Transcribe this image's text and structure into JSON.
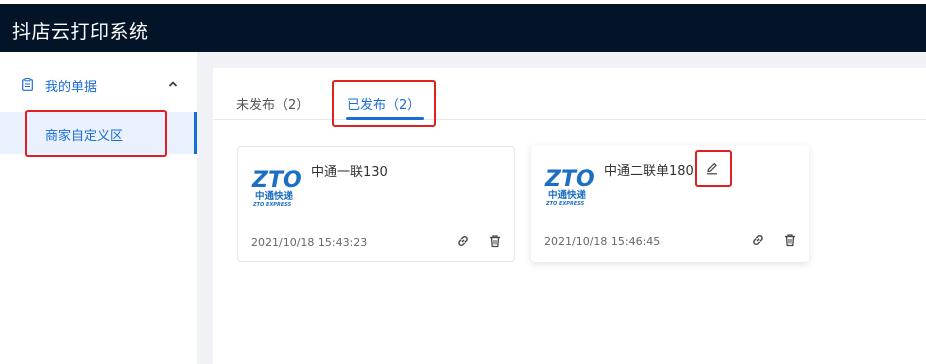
{
  "app": {
    "title": "抖店云打印系统"
  },
  "sidebar": {
    "group": {
      "label": "我的单据",
      "icon": "document-icon",
      "toggle_icon": "chevron-up-icon"
    },
    "items": [
      {
        "label": "商家自定义区",
        "active": true
      }
    ]
  },
  "tabs": [
    {
      "label": "未发布（2）",
      "active": false
    },
    {
      "label": "已发布（2）",
      "active": true
    }
  ],
  "cards": [
    {
      "name": "中通一联130",
      "date": "2021/10/18 15:43:23",
      "logo_text": "ZTO",
      "logo_sub": "中通快递",
      "logo_caption": "ZTO EXPRESS"
    },
    {
      "name": "中通二联单180",
      "date": "2021/10/18 15:46:45",
      "logo_text": "ZTO",
      "logo_sub": "中通快递",
      "logo_caption": "ZTO EXPRESS"
    }
  ],
  "colors": {
    "topbar": "#041428",
    "accent": "#1a6cd6",
    "highlight": "#e02020",
    "logo": "#1d6fc4"
  }
}
